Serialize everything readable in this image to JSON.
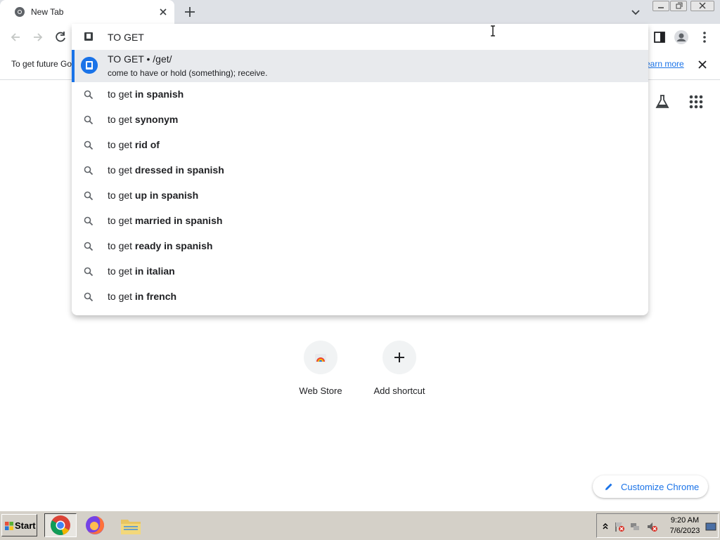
{
  "browser": {
    "tab_title": "New Tab",
    "omnibox_text": "TO GET"
  },
  "infobar": {
    "text": "To get future Go",
    "link": "earn more"
  },
  "omnibox": {
    "answer": {
      "title": "TO GET • /get/",
      "definition": "come to have or hold (something); receive."
    },
    "suggestions": [
      {
        "prefix": "to get ",
        "bold": "in spanish"
      },
      {
        "prefix": "to get ",
        "bold": "synonym"
      },
      {
        "prefix": "to get ",
        "bold": "rid of"
      },
      {
        "prefix": "to get ",
        "bold": "dressed in spanish"
      },
      {
        "prefix": "to get ",
        "bold": "up in spanish"
      },
      {
        "prefix": "to get ",
        "bold": "married in spanish"
      },
      {
        "prefix": "to get ",
        "bold": "ready in spanish"
      },
      {
        "prefix": "to get ",
        "bold": "in italian"
      },
      {
        "prefix": "to get ",
        "bold": "in french"
      }
    ]
  },
  "ntp": {
    "shortcuts": [
      {
        "label": "Web Store",
        "icon": "web-store-icon"
      },
      {
        "label": "Add shortcut",
        "icon": "plus-icon"
      }
    ],
    "customize_label": "Customize Chrome"
  },
  "taskbar": {
    "start_label": "Start",
    "time": "9:20 AM",
    "date": "7/6/2023"
  },
  "colors": {
    "accent": "#1a73e8",
    "tabstrip": "#dee1e6",
    "selected_row": "#e8eaed",
    "taskbar": "#d4d0c8"
  }
}
